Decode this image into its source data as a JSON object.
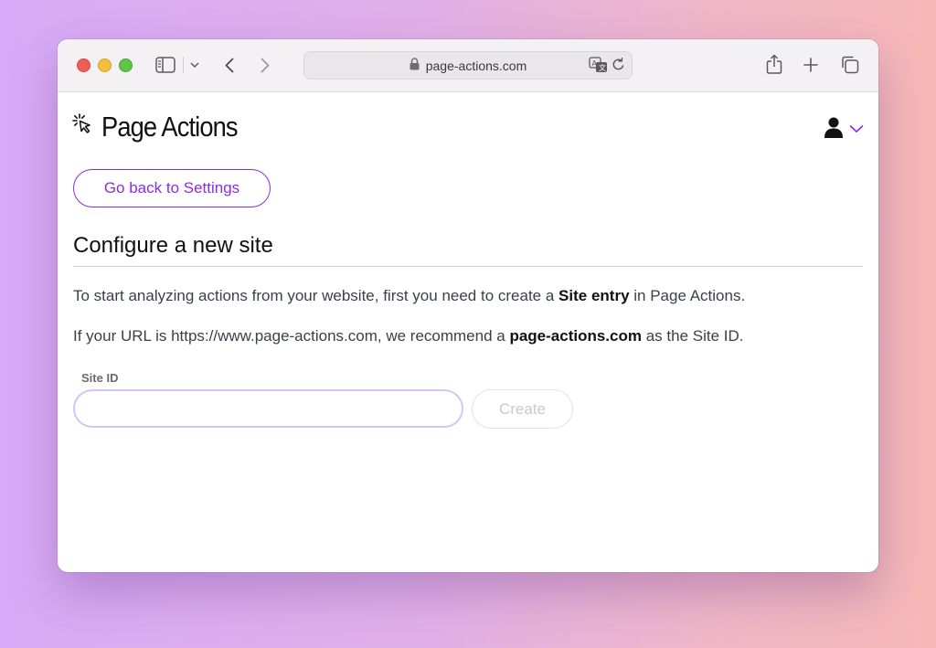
{
  "browser": {
    "url": "page-actions.com",
    "icons": [
      "sidebar-icon",
      "chevron-down-icon",
      "back-icon",
      "forward-icon",
      "lock-icon",
      "translate-icon",
      "reload-icon",
      "share-icon",
      "new-tab-icon",
      "tabs-overview-icon"
    ]
  },
  "app": {
    "name": "Page Actions",
    "logo_icon": "cursor-click-icon",
    "user_icon": "user-icon",
    "accent_color": "#8b2be2"
  },
  "nav": {
    "back_label": "Go back to Settings"
  },
  "section": {
    "title": "Configure a new site"
  },
  "intro": {
    "p1_before": "To start analyzing actions from your website, first you need to create a ",
    "p1_bold": "Site entry",
    "p1_after": " in Page Actions.",
    "p2_before": "If your URL is https://www.page-actions.com, we recommend a ",
    "p2_bold": "page-actions.com",
    "p2_after": " as the Site ID."
  },
  "form": {
    "site_id_label": "Site ID",
    "site_id_value": "",
    "create_label": "Create"
  }
}
